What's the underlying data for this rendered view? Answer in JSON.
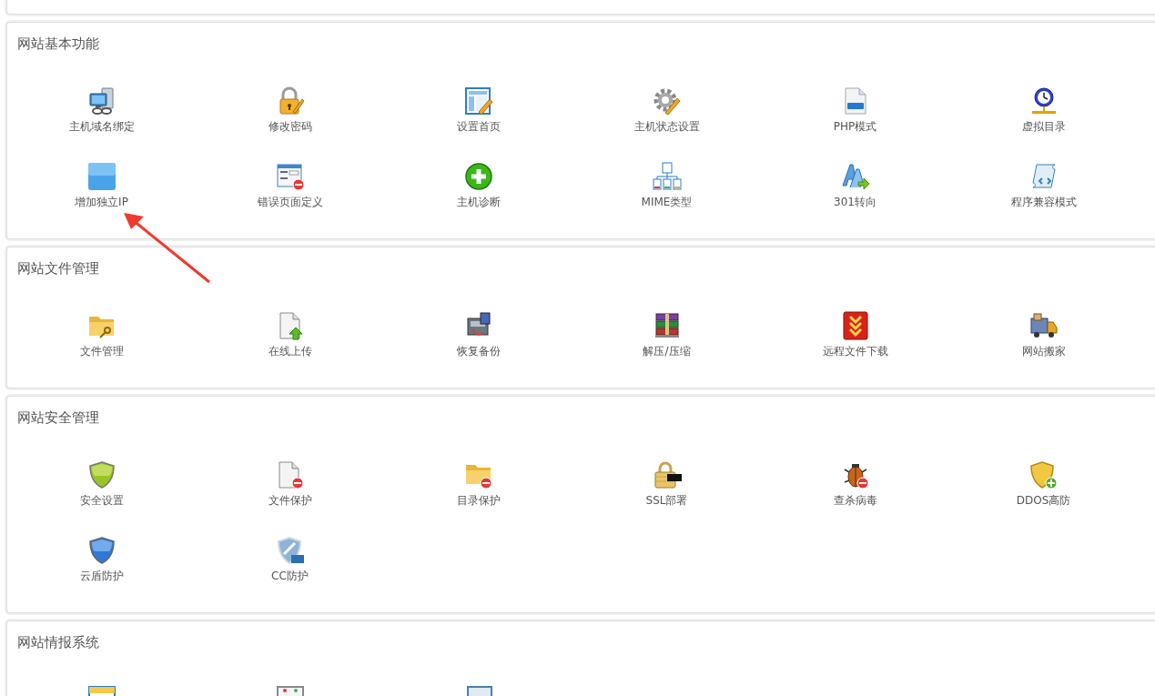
{
  "sections": [
    {
      "title": "网站基本功能",
      "items": [
        {
          "label": "主机域名绑定",
          "kind": "server"
        },
        {
          "label": "修改密码",
          "kind": "lock"
        },
        {
          "label": "设置首页",
          "kind": "layout"
        },
        {
          "label": "主机状态设置",
          "kind": "gear"
        },
        {
          "label": "PHP模式",
          "kind": "phpfile"
        },
        {
          "label": "虚拟目录",
          "kind": "clock"
        },
        {
          "label": "增加独立IP",
          "kind": "ip"
        },
        {
          "label": "错误页面定义",
          "kind": "winerror"
        },
        {
          "label": "主机诊断",
          "kind": "plus"
        },
        {
          "label": "MIME类型",
          "kind": "tree"
        },
        {
          "label": "301转向",
          "kind": "letters"
        },
        {
          "label": "程序兼容模式",
          "kind": "scroll"
        }
      ]
    },
    {
      "title": "网站文件管理",
      "items": [
        {
          "label": "文件管理",
          "kind": "folder"
        },
        {
          "label": "在线上传",
          "kind": "upload"
        },
        {
          "label": "恢复备份",
          "kind": "disk"
        },
        {
          "label": "解压/压缩",
          "kind": "archive"
        },
        {
          "label": "远程文件下载",
          "kind": "download"
        },
        {
          "label": "网站搬家",
          "kind": "truck"
        }
      ]
    },
    {
      "title": "网站安全管理",
      "items": [
        {
          "label": "安全设置",
          "kind": "shieldgreen"
        },
        {
          "label": "文件保护",
          "kind": "fileerror"
        },
        {
          "label": "目录保护",
          "kind": "foldererror"
        },
        {
          "label": "SSL部署",
          "kind": "ssl"
        },
        {
          "label": "查杀病毒",
          "kind": "bug"
        },
        {
          "label": "DDOS高防",
          "kind": "shieldplus"
        },
        {
          "label": "云盾防护",
          "kind": "shieldblue"
        },
        {
          "label": "CC防护",
          "kind": "shieldcc"
        }
      ]
    },
    {
      "title": "网站情报系统",
      "items": [
        {
          "kind": "calendar"
        },
        {
          "kind": "chartdoc"
        },
        {
          "kind": "monitor"
        }
      ]
    }
  ]
}
